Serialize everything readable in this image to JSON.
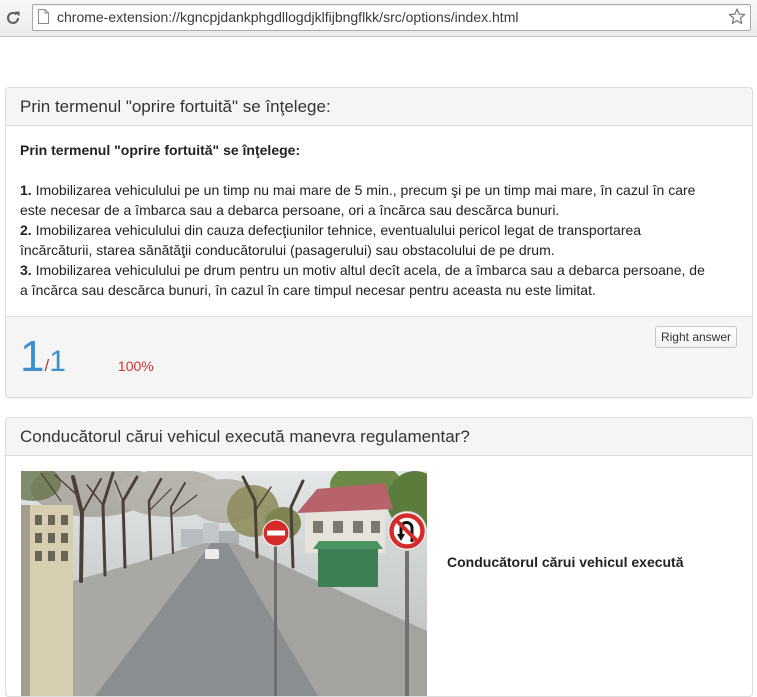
{
  "browser": {
    "url": "chrome-extension://kgncpjdankphgdllogdjklfijbngflkk/src/options/index.html",
    "icons": {
      "reload": "reload-icon",
      "page": "page-icon",
      "bookmark": "star-icon"
    }
  },
  "colors": {
    "score": "#3f8fcf",
    "score_separator": "#a4403c",
    "percent": "#d0342c",
    "panel_header_bg": "#f5f5f5",
    "panel_border": "#dddddd"
  },
  "questions": [
    {
      "title": "Prin termenul \"oprire fortuită\" se înţelege:",
      "text_title": "Prin termenul \"oprire fortuită\" se înţelege:",
      "answers": [
        {
          "num": "1.",
          "text": "Imobilizarea vehiculului pe un timp nu mai mare de 5 min., precum şi pe un timp mai mare, în cazul în care este necesar de a îmbarca sau a debarca persoane, ori a încărca sau descărca bunuri."
        },
        {
          "num": "2.",
          "text": "Imobilizarea vehiculului din cauza defecţiunilor tehnice, eventualului pericol legat de transportarea încărcăturii, starea sănătăţii conducătorului (pasagerului) sau obstacolului de pe drum."
        },
        {
          "num": "3.",
          "text": "Imobilizarea vehiculului pe drum pentru un motiv altul decît acela, de a îmbarca sau a debarca persoane, de a încărca sau descărca bunuri, în cazul în care timpul necesar pentru aceasta nu este limitat."
        }
      ],
      "score": {
        "correct": 1,
        "separator": "/",
        "total": 1,
        "percent": "100%"
      },
      "button": "Right answer"
    },
    {
      "title": "Conducătorul cărui vehicul execută manevra regulamentar?",
      "text_title": "Conducătorul cărui vehicul execută"
    }
  ]
}
